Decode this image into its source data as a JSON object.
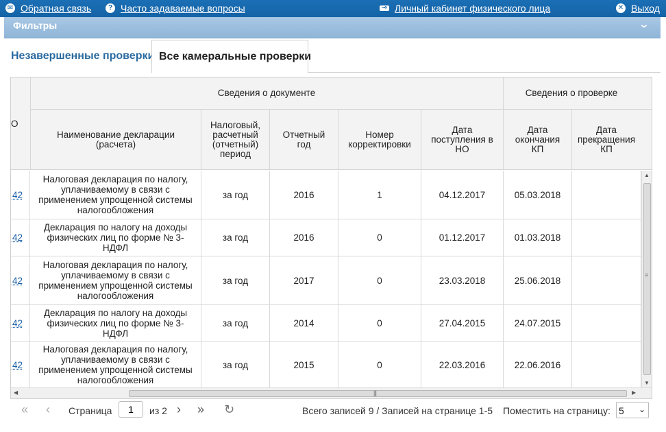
{
  "topbar": {
    "feedback": "Обратная связь",
    "faq": "Часто задаваемые вопросы",
    "cabinet": "Личный кабинет физического лица",
    "exit": "Выход"
  },
  "filters": {
    "title": "Фильтры"
  },
  "tabs": [
    {
      "label": "Незавершенные проверки",
      "active": false
    },
    {
      "label": "Все камеральные проверки",
      "active": true
    }
  ],
  "table": {
    "group_headers": {
      "document": "Сведения о документе",
      "check": "Сведения о проверке"
    },
    "first_col_fragment": "О",
    "columns": [
      "Наименование декларации (расчета)",
      "Налоговый, расчетный (отчетный) период",
      "Отчетный год",
      "Номер корректировки",
      "Дата поступления в НО",
      "Дата окончания КП",
      "Дата прекращения КП"
    ],
    "rows": [
      {
        "num": "42",
        "name": "Налоговая декларация по налогу, уплачиваемому в связи с применением упрощенной системы налогообложения",
        "period": "за год",
        "year": "2016",
        "corr": "1",
        "received": "04.12.2017",
        "end": "05.03.2018",
        "stop": ""
      },
      {
        "num": "42",
        "name": "Декларация по налогу на доходы физических лиц по форме № 3-НДФЛ",
        "period": "за год",
        "year": "2016",
        "corr": "0",
        "received": "01.12.2017",
        "end": "01.03.2018",
        "stop": ""
      },
      {
        "num": "42",
        "name": "Налоговая декларация по налогу, уплачиваемому в связи с применением упрощенной системы налогообложения",
        "period": "за год",
        "year": "2017",
        "corr": "0",
        "received": "23.03.2018",
        "end": "25.06.2018",
        "stop": ""
      },
      {
        "num": "42",
        "name": "Декларация по налогу на доходы физических лиц по форме № 3-НДФЛ",
        "period": "за год",
        "year": "2014",
        "corr": "0",
        "received": "27.04.2015",
        "end": "24.07.2015",
        "stop": ""
      },
      {
        "num": "42",
        "name": "Налоговая декларация по налогу, уплачиваемому в связи с применением упрощенной системы налогообложения",
        "period": "за год",
        "year": "2015",
        "corr": "0",
        "received": "22.03.2016",
        "end": "22.06.2016",
        "stop": ""
      }
    ]
  },
  "pager": {
    "page_label": "Страница",
    "page_value": "1",
    "of_label": "из 2",
    "summary": "Всего записей 9 / Записей на странице 1-5",
    "per_page_label": "Поместить на страницу:",
    "per_page_value": "5"
  },
  "icons": {
    "feedback": "mail-icon",
    "faq": "help-icon",
    "cabinet": "key-icon",
    "exit": "close-icon",
    "first": "double-chevron-left-icon",
    "prev": "chevron-left-icon",
    "next": "chevron-right-icon",
    "last": "double-chevron-right-icon",
    "refresh": "refresh-icon"
  },
  "colors": {
    "topbar": "#1563a6",
    "filters": "#9dbfe0",
    "link": "#1a5fa8",
    "tab_inactive": "#2a6aa0"
  }
}
